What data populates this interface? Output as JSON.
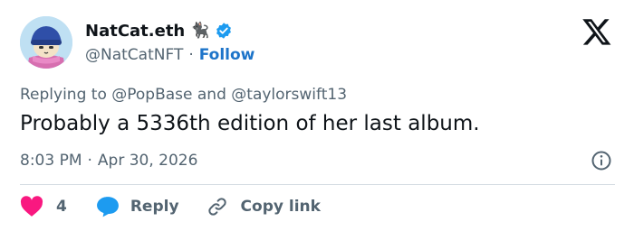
{
  "author": {
    "display_name": "NatCat.eth",
    "badge_emoji": "🐈‍⬛",
    "handle": "@NatCatNFT",
    "separator": "·",
    "follow_label": "Follow",
    "verified": true
  },
  "tweet": {
    "replying_to_prefix": "Replying to",
    "reply_user_1": "@PopBase",
    "reply_and": "and",
    "reply_user_2": "@taylorswift13",
    "text": "Probably a 5336th edition of her last album.",
    "time": "8:03 PM",
    "meta_separator": "·",
    "date": "Apr 30, 2026"
  },
  "actions": {
    "like_count": "4",
    "reply_label": "Reply",
    "copy_link_label": "Copy link"
  },
  "colors": {
    "like": "#f91880",
    "reply": "#1d9bf0",
    "verified": "#1d9bf0",
    "follow": "#1d74c9",
    "muted": "#536471"
  },
  "icons": [
    "avatar-cat-image",
    "black-cat-emoji",
    "verified-badge-icon",
    "x-logo-icon",
    "info-icon",
    "heart-icon",
    "reply-bubble-icon",
    "link-icon"
  ]
}
